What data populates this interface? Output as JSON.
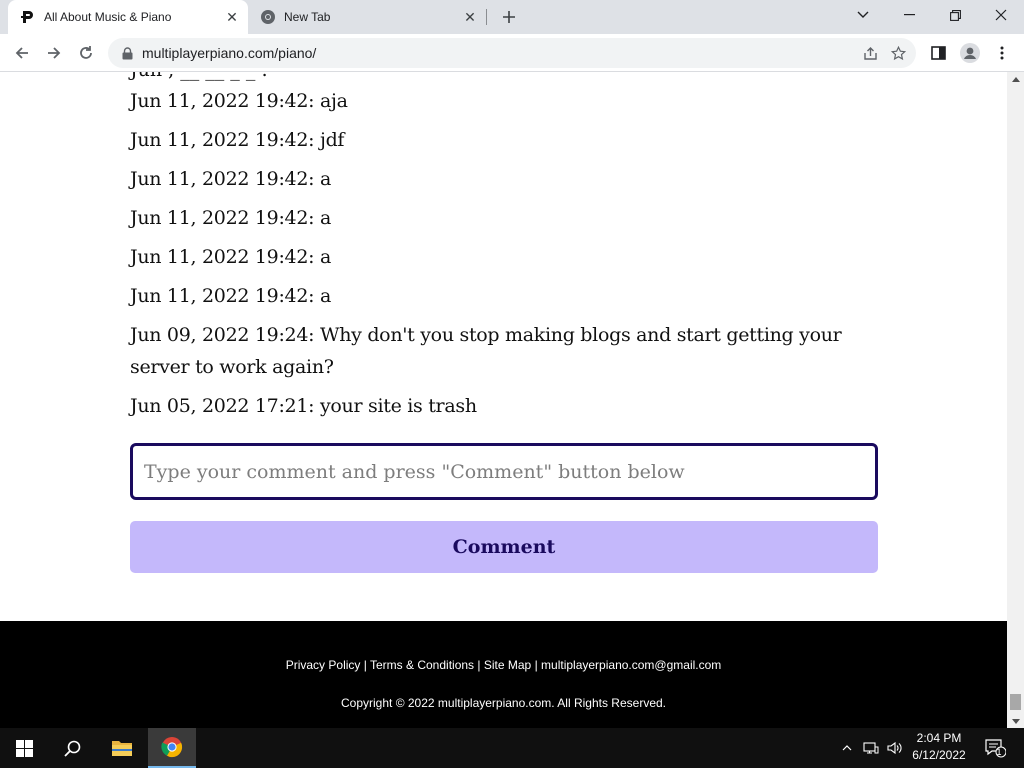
{
  "browser": {
    "tabs": [
      {
        "title": "All About Music & Piano",
        "active": true
      },
      {
        "title": "New Tab",
        "active": false
      }
    ],
    "url": "multiplayerpiano.com/piano/"
  },
  "comments": [
    {
      "text": "Jun 11, 2022 19:42: aja"
    },
    {
      "text": "Jun 11, 2022 19:42: jdf"
    },
    {
      "text": "Jun 11, 2022 19:42: a"
    },
    {
      "text": "Jun 11, 2022 19:42: a"
    },
    {
      "text": "Jun 11, 2022 19:42: a"
    },
    {
      "text": "Jun 11, 2022 19:42: a"
    },
    {
      "text": "Jun 09, 2022 19:24: Why don't you stop making blogs and start getting your server to work again?"
    },
    {
      "text": "Jun 05, 2022 17:21: your site is trash"
    }
  ],
  "comment_form": {
    "placeholder": "Type your comment and press \"Comment\" button below",
    "button_label": "Comment"
  },
  "footer": {
    "links": [
      {
        "label": "Privacy Policy"
      },
      {
        "label": "Terms & Conditions"
      },
      {
        "label": "Site Map"
      },
      {
        "label": "multiplayerpiano.com@gmail.com"
      }
    ],
    "separator": "|",
    "copyright": "Copyright © 2022 multiplayerpiano.com. All Rights Reserved."
  },
  "taskbar": {
    "time": "2:04 PM",
    "date": "6/12/2022",
    "notification_count": "1"
  },
  "colors": {
    "accent": "#c4b8fb",
    "input_border": "#1a0a5e",
    "footer_bg": "#000000"
  }
}
